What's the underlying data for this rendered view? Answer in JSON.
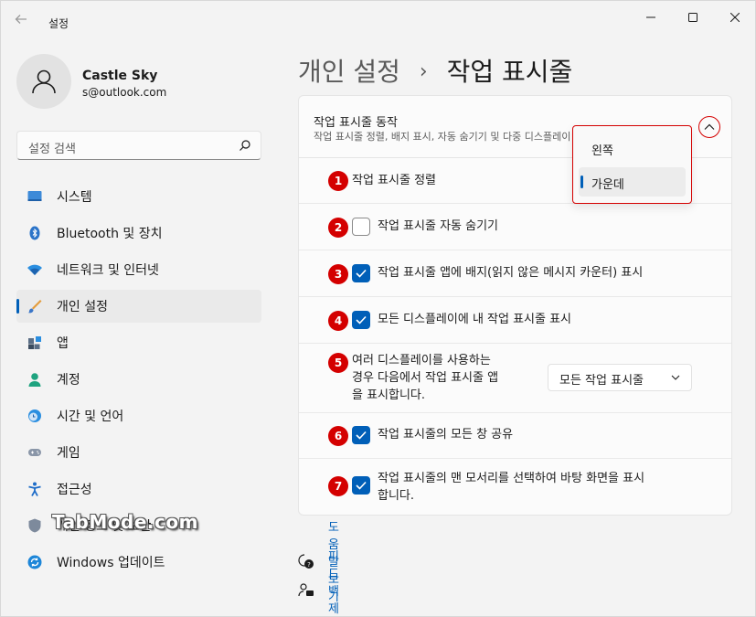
{
  "window": {
    "app_title": "설정",
    "controls": [
      "minimize-icon",
      "maximize-icon",
      "close-icon"
    ]
  },
  "profile": {
    "name": "Castle Sky",
    "email": "s@outlook.com"
  },
  "search": {
    "placeholder": "설정 검색"
  },
  "sidebar": {
    "items": [
      {
        "label": "시스템",
        "icon": "system-icon"
      },
      {
        "label": "Bluetooth 및 장치",
        "icon": "bluetooth-icon"
      },
      {
        "label": "네트워크 및 인터넷",
        "icon": "network-icon"
      },
      {
        "label": "개인 설정",
        "icon": "personalization-icon",
        "active": true
      },
      {
        "label": "앱",
        "icon": "apps-icon"
      },
      {
        "label": "계정",
        "icon": "accounts-icon"
      },
      {
        "label": "시간 및 언어",
        "icon": "time-language-icon"
      },
      {
        "label": "게임",
        "icon": "gaming-icon"
      },
      {
        "label": "접근성",
        "icon": "accessibility-icon"
      },
      {
        "label": "개인 정보 및 보안",
        "icon": "privacy-shield-icon"
      },
      {
        "label": "Windows 업데이트",
        "icon": "windows-update-icon"
      }
    ]
  },
  "breadcrumb": {
    "parent": "개인 설정",
    "separator": "›",
    "current": "작업 표시줄"
  },
  "behaviors": {
    "title": "작업 표시줄 동작",
    "subtitle": "작업 표시줄 정렬, 배지 표시, 자동 숨기기 및 다중 디스플레이",
    "rows": [
      {
        "badge": "1",
        "label": "작업 표시줄 정렬",
        "type": "select"
      },
      {
        "badge": "2",
        "label": "작업 표시줄 자동 숨기기",
        "checked": false
      },
      {
        "badge": "3",
        "label": "작업 표시줄 앱에 배지(읽지 않은 메시지 카운터) 표시",
        "checked": true
      },
      {
        "badge": "4",
        "label": "모든 디스플레이에 내 작업 표시줄 표시",
        "checked": true
      },
      {
        "badge": "5",
        "label_lines": [
          "여러 디스플레이를 사용하는",
          "경우 다음에서 작업 표시줄 앱",
          "을 표시합니다."
        ],
        "dropdown_value": "모든 작업 표시줄"
      },
      {
        "badge": "6",
        "label": "작업 표시줄의 모든 창 공유",
        "checked": true
      },
      {
        "badge": "7",
        "label_lines": [
          "작업 표시줄의 맨 모서리를 선택하여 바탕 화면을 표시",
          "합니다."
        ],
        "checked": true
      }
    ]
  },
  "alignment_popup": {
    "options": [
      "왼쪽",
      "가운데"
    ],
    "selected": "가운데"
  },
  "watermark": "TabMode.com",
  "help": {
    "get_help": "도움말 보기",
    "feedback": "피드백 제공"
  },
  "colors": {
    "accent": "#005fb8",
    "highlight_red": "#d40000",
    "background": "#f3f3f3"
  }
}
